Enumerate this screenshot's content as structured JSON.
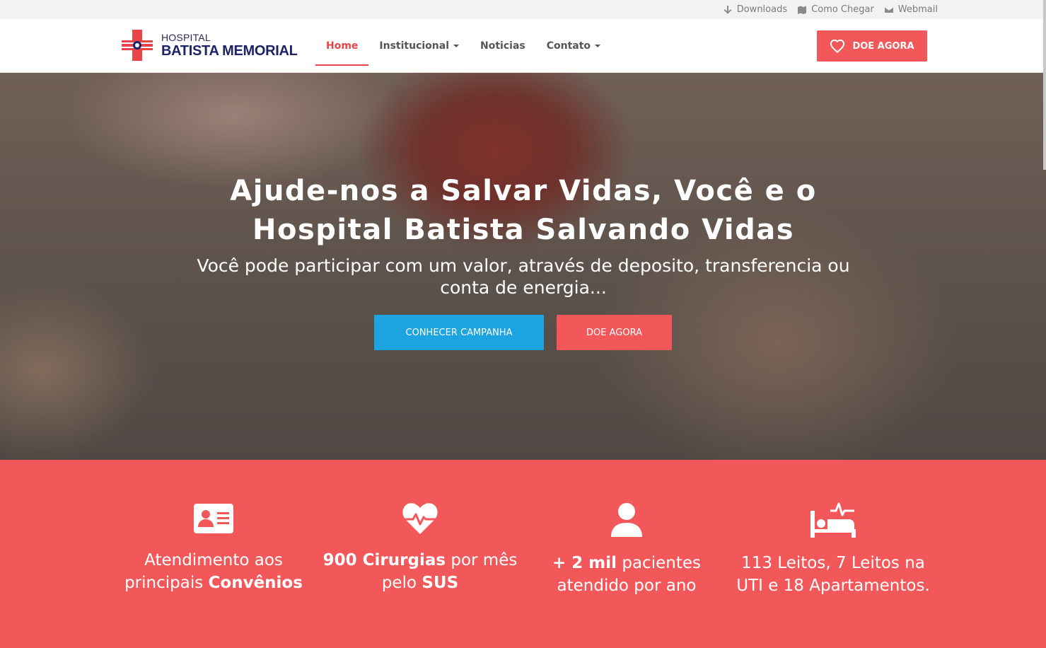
{
  "topbar": {
    "links": [
      {
        "label": "Downloads",
        "icon": "arrow-down-icon"
      },
      {
        "label": "Como Chegar",
        "icon": "map-icon"
      },
      {
        "label": "Webmail",
        "icon": "envelope-icon"
      }
    ]
  },
  "brand": {
    "small": "HOSPITAL",
    "big": "BATISTA MEMORIAL",
    "colors": {
      "red": "#e9444a",
      "navy": "#1d2366"
    }
  },
  "nav": {
    "items": [
      {
        "label": "Home",
        "active": true
      },
      {
        "label": "Institucional",
        "dropdown": true
      },
      {
        "label": "Noticias"
      },
      {
        "label": "Contato",
        "dropdown": true
      }
    ],
    "donate_label": "DOE AGORA"
  },
  "hero": {
    "title_line1": "Ajude-nos a Salvar Vidas, Você e o",
    "title_line2": "Hospital Batista Salvando Vidas",
    "subtitle_line1": "Você pode participar com um valor, através de deposito, transferencia ou",
    "subtitle_line2": "conta de energia...",
    "btn_campaign": "CONHECER CAMPANHA",
    "btn_donate": "DOE AGORA"
  },
  "features": [
    {
      "icon": "id-card-icon",
      "l1a": "Atendimento aos",
      "l1b": "",
      "l1c": "",
      "l2a": "principais ",
      "l2b": "Convênios",
      "l2c": ""
    },
    {
      "icon": "heartbeat-icon",
      "l1a": "",
      "l1b": "900 Cirurgias",
      "l1c": " por mês",
      "l2a": "pelo ",
      "l2b": "SUS",
      "l2c": ""
    },
    {
      "icon": "user-icon",
      "l1a": "",
      "l1b": "+ 2 mil",
      "l1c": " pacientes",
      "l2a": "atendido por ano",
      "l2b": "",
      "l2c": ""
    },
    {
      "icon": "hospital-bed-icon",
      "l1a": "113 Leitos, 7 Leitos na",
      "l1b": "",
      "l1c": "",
      "l2a": "UTI e 18 Apartamentos.",
      "l2b": "",
      "l2c": ""
    }
  ],
  "colors": {
    "accent": "#f2575a",
    "blue": "#1ba4e0"
  }
}
